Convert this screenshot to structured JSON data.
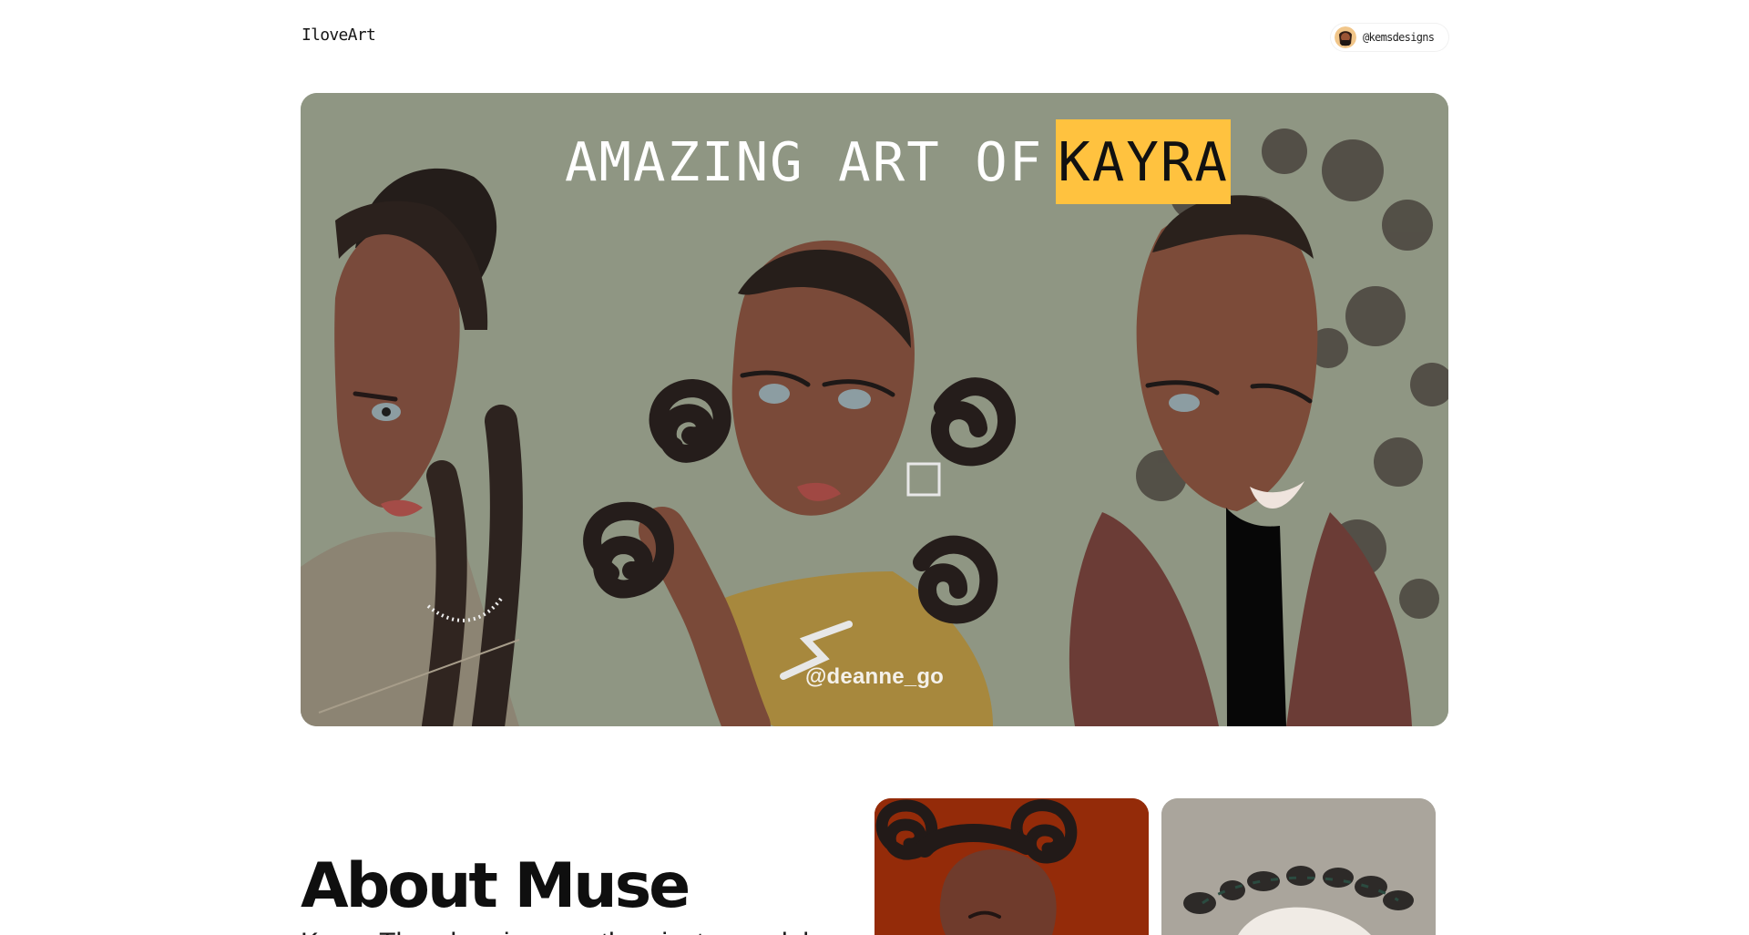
{
  "header": {
    "logo": "IloveArt",
    "profile_handle": "@kemsdesigns",
    "avatar_icon": "portrait-avatar-icon"
  },
  "hero": {
    "title_prefix": "Amazing art of",
    "title_highlight": "Kayra",
    "credit": "@deanne_go",
    "highlight_color": "#ffc23f",
    "background_color": "#8f9683"
  },
  "about": {
    "title": "About Muse",
    "intro": "Kayra Theodore is more than just a model;"
  },
  "gallery": {
    "card_colors": [
      "#942b09",
      "#aaa59c"
    ]
  }
}
